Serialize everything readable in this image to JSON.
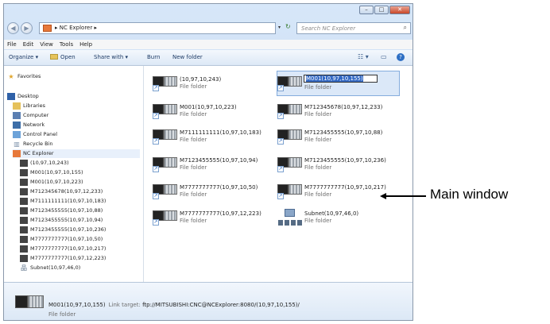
{
  "window": {
    "minimize": "–",
    "maximize": "□",
    "close": "✕"
  },
  "addressbar": {
    "back": "◀",
    "forward": "▶",
    "path_sep": "▸",
    "path": "NC Explorer",
    "dropdown": "▾",
    "refresh": "↻",
    "search_placeholder": "Search NC Explorer",
    "search_icon": "⌕"
  },
  "menu": [
    "File",
    "Edit",
    "View",
    "Tools",
    "Help"
  ],
  "toolbar": {
    "organize": "Organize ▾",
    "open": "Open",
    "share": "Share with ▾",
    "burn": "Burn",
    "newfolder": "New folder",
    "views": "☷ ▾",
    "preview": "▭",
    "help": "?"
  },
  "nav": {
    "favorites": "Favorites",
    "desktop": "Desktop",
    "libraries": "Libraries",
    "computer": "Computer",
    "network": "Network",
    "control_panel": "Control Panel",
    "recycle": "Recycle Bin",
    "nc_explorer": "NC Explorer",
    "children": [
      "(10,97,10,243)",
      "M001(10,97,10,155)",
      "M001(10,97,10,223)",
      "M712345678(10,97,12,233)",
      "M7111111111(10,97,10,183)",
      "M7123455555(10,97,10,88)",
      "M7123455555(10,97,10,94)",
      "M7123455555(10,97,10,236)",
      "M7777777777(10,97,10,50)",
      "M7777777777(10,97,10,217)",
      "M7777777777(10,97,12,223)",
      "Subnet(10,97,46,0)"
    ]
  },
  "files": [
    {
      "name": "(10,97,10,243)",
      "type": "File folder"
    },
    {
      "name": "M001(10,97,10,155)",
      "type": "File folder",
      "selected": true
    },
    {
      "name": "M001(10,97,10,223)",
      "type": "File folder"
    },
    {
      "name": "M712345678(10,97,12,233)",
      "type": "File folder"
    },
    {
      "name": "M7111111111(10,97,10,183)",
      "type": "File folder"
    },
    {
      "name": "M7123455555(10,97,10,88)",
      "type": "File folder"
    },
    {
      "name": "M7123455555(10,97,10,94)",
      "type": "File folder"
    },
    {
      "name": "M7123455555(10,97,10,236)",
      "type": "File folder"
    },
    {
      "name": "M7777777777(10,97,10,50)",
      "type": "File folder"
    },
    {
      "name": "M7777777777(10,97,10,217)",
      "type": "File folder"
    },
    {
      "name": "M7777777777(10,97,12,223)",
      "type": "File folder"
    },
    {
      "name": "Subnet(10,97,46,0)",
      "type": "File folder"
    }
  ],
  "details": {
    "name": "M001(10,97,10,155)",
    "link_label": "Link target:",
    "link_target": "ftp://MITSUBISHI:CNC@NCExplorer:8080/(10,97,10,155)/",
    "type": "File folder"
  },
  "annotation": "Main window"
}
